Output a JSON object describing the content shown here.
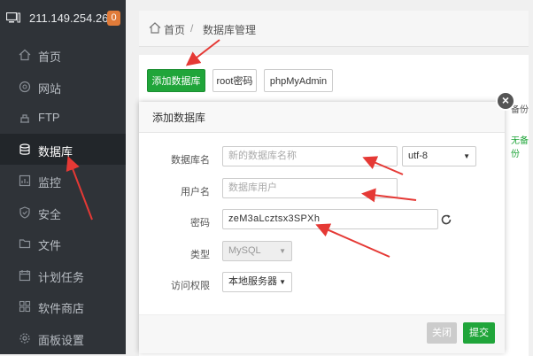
{
  "server": {
    "ip": "211.149.254.26",
    "badge": "0"
  },
  "sidebar": {
    "items": [
      {
        "label": "首页",
        "icon": "home-icon"
      },
      {
        "label": "网站",
        "icon": "globe-icon"
      },
      {
        "label": "FTP",
        "icon": "ftp-icon"
      },
      {
        "label": "数据库",
        "icon": "database-icon",
        "active": true
      },
      {
        "label": "监控",
        "icon": "monitor-icon"
      },
      {
        "label": "安全",
        "icon": "shield-icon"
      },
      {
        "label": "文件",
        "icon": "folder-icon"
      },
      {
        "label": "计划任务",
        "icon": "calendar-icon"
      },
      {
        "label": "软件商店",
        "icon": "apps-icon"
      },
      {
        "label": "面板设置",
        "icon": "gear-icon"
      }
    ]
  },
  "breadcrumb": {
    "home": "首页",
    "separator": "/",
    "current": "数据库管理"
  },
  "toolbar": {
    "add": "添加数据库",
    "root": "root密码",
    "phpmyadmin": "phpMyAdmin"
  },
  "table": {
    "backup_header": "备份",
    "no_backup": "无备份"
  },
  "modal": {
    "title": "添加数据库",
    "db_name_label": "数据库名",
    "db_name_placeholder": "新的数据库名称",
    "charset": "utf-8",
    "user_label": "用户名",
    "user_placeholder": "数据库用户",
    "password_label": "密码",
    "password_value": "zeM3aLcztsx3SPXh",
    "type_label": "类型",
    "type_value": "MySQL",
    "access_label": "访问权限",
    "access_value": "本地服务器",
    "close_button": "关闭",
    "submit_button": "提交"
  },
  "colors": {
    "accent": "#20a53a",
    "sidebar_bg": "#2f3338",
    "annotation": "#e53935",
    "badge": "#e07b39"
  }
}
